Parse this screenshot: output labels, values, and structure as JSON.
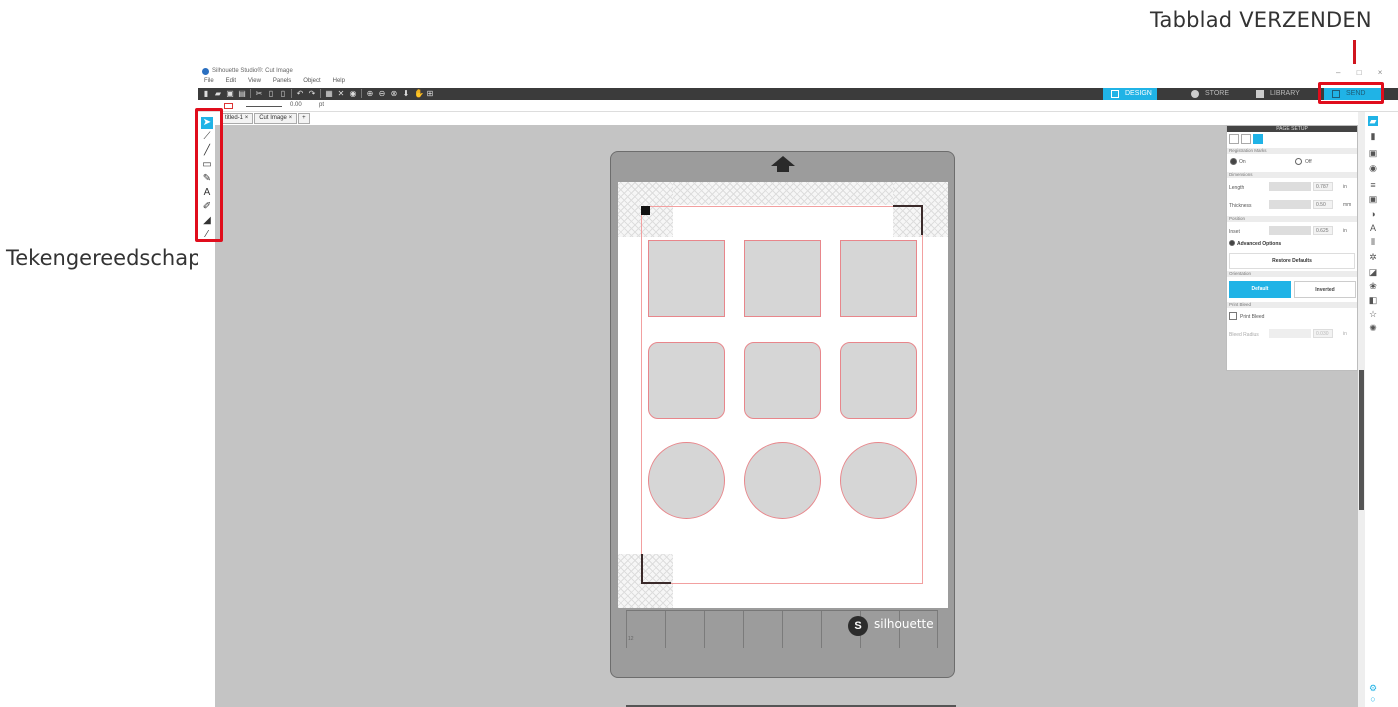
{
  "annotations": {
    "send_tab_label": "Tabblad VERZENDEN",
    "drawing_tools_label": "Tekengereedschap"
  },
  "window": {
    "title": "Silhouette Studio®: Cut Image",
    "controls": [
      "–",
      "□",
      "×"
    ]
  },
  "menu": [
    "File",
    "Edit",
    "View",
    "Panels",
    "Object",
    "Help"
  ],
  "nav_tabs": {
    "design": "DESIGN",
    "store": "STORE",
    "library": "LIBRARY",
    "send": "SEND"
  },
  "property_bar": {
    "line_width_value": "0.00",
    "line_width_unit": "pt"
  },
  "doc_tabs": [
    {
      "label": "titled-1",
      "close": "×"
    },
    {
      "label": "Cut Image",
      "close": "×"
    },
    {
      "label": "+"
    }
  ],
  "mat": {
    "brand": "silhouette",
    "ruler_number": "12"
  },
  "page_setup": {
    "title": "PAGE SETUP",
    "registration_marks": {
      "section": "Registration Marks",
      "on_label": "On",
      "off_label": "Off",
      "selected": "On"
    },
    "dimensions": {
      "section": "Dimensions",
      "length_label": "Length",
      "length_value": "0.787",
      "length_unit": "in",
      "thickness_label": "Thickness",
      "thickness_value": "0.50",
      "thickness_unit": "mm"
    },
    "position": {
      "section": "Position",
      "inset_label": "Inset",
      "inset_value": "0.625",
      "inset_unit": "in"
    },
    "advanced_options": "Advanced Options",
    "restore_defaults": "Restore Defaults",
    "orientation": {
      "section": "Orientation",
      "default_label": "Default",
      "inverted_label": "Inverted",
      "selected": "Default"
    },
    "print_bleed": {
      "section": "Print Bleed",
      "checkbox_label": "Print Bleed",
      "radius_label": "Bleed Radius",
      "radius_value": "0.030",
      "radius_unit": "in"
    }
  },
  "colors": {
    "accent": "#20b3e6",
    "annotation_red": "#e00d1c",
    "toolbar": "#3b3b3b",
    "canvas": "#c4c4c4",
    "mat": "#9c9c9c"
  }
}
